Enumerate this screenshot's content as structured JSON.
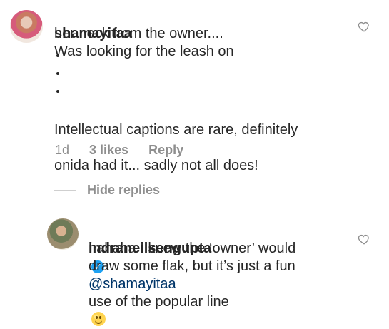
{
  "comment": {
    "username": "shamayitaa",
    "line1_text": "Was looking for the leash on",
    "line2_text": "her neck from the owner....",
    "body_line1": "Intellectual captions are rare, definitely",
    "body_line2": "onida had it... sadly not all does!",
    "time": "1d",
    "likes": "3 likes",
    "reply": "Reply"
  },
  "thread": {
    "hide_replies": "Hide replies"
  },
  "reply_comment": {
    "username": "indraneilsengupta",
    "mention": "@shamayitaa",
    "line2": "hahaha I knew the ‘owner’ would",
    "line3": "draw some flak, but it’s just a fun",
    "line4": "use of the popular line"
  }
}
